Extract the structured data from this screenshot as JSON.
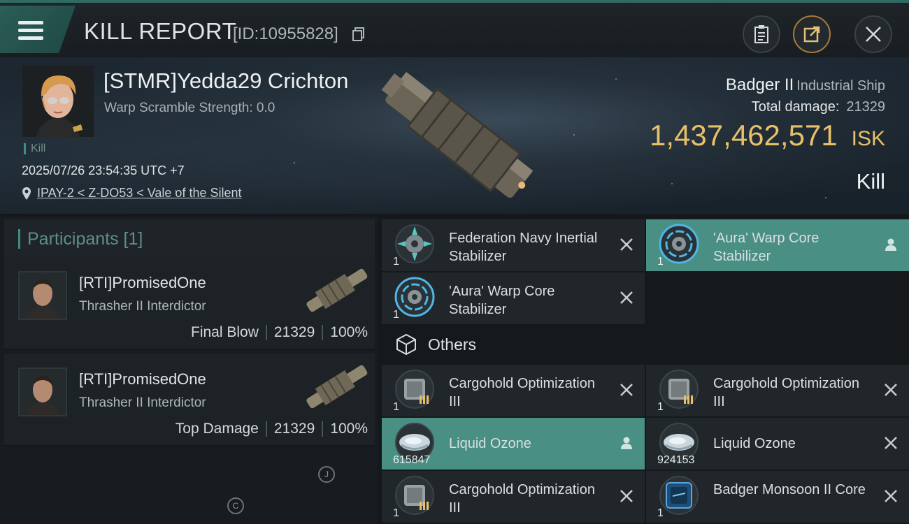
{
  "header": {
    "title": "KILL REPORT",
    "report_id": "[ID:10955828]",
    "menu_icon": "hamburger-icon",
    "actions": [
      {
        "name": "clipboard-icon"
      },
      {
        "name": "share-icon"
      },
      {
        "name": "close-icon"
      }
    ]
  },
  "victim": {
    "name": "[STMR]Yedda29 Crichton",
    "warp_scramble": "Warp Scramble Strength: 0.0",
    "tag": "Kill",
    "datetime": "2025/07/26 23:54:35 UTC +7",
    "location": "IPAY-2 < Z-DO53 < Vale of the Silent",
    "ship_name": "Badger II",
    "ship_class": "Industrial Ship",
    "total_damage_label": "Total damage:",
    "total_damage": "21329",
    "isk_value": "1,437,462,571",
    "isk_unit": "ISK",
    "result": "Kill"
  },
  "participants": {
    "title": "Participants [1]",
    "list": [
      {
        "name": "[RTI]PromisedOne",
        "ship": "Thrasher II Interdictor",
        "role": "Final Blow",
        "damage": "21329",
        "percent": "100%"
      },
      {
        "name": "[RTI]PromisedOne",
        "ship": "Thrasher II Interdictor",
        "role": "Top Damage",
        "damage": "21329",
        "percent": "100%"
      }
    ],
    "markers": [
      "J",
      "C"
    ]
  },
  "items": {
    "fitted": [
      {
        "name": "Federation Navy Inertial Stabilizer",
        "qty": "1",
        "status": "destroyed"
      },
      {
        "name": "'Aura' Warp Core Stabilizer",
        "qty": "1",
        "status": "dropped"
      },
      {
        "name": "'Aura' Warp Core Stabilizer",
        "qty": "1",
        "status": "destroyed"
      }
    ],
    "others_label": "Others",
    "others": [
      {
        "name": "Cargohold Optimization III",
        "qty": "1",
        "status": "destroyed"
      },
      {
        "name": "Cargohold Optimization III",
        "qty": "1",
        "status": "destroyed"
      },
      {
        "name": "Liquid Ozone",
        "qty": "615847",
        "status": "dropped"
      },
      {
        "name": "Liquid Ozone",
        "qty": "924153",
        "status": "destroyed"
      },
      {
        "name": "Cargohold Optimization III",
        "qty": "1",
        "status": "destroyed"
      },
      {
        "name": "Badger Monsoon II Core",
        "qty": "1",
        "status": "destroyed"
      }
    ]
  },
  "colors": {
    "accent": "#4a8f84",
    "isk": "#e8c06a",
    "background": "#14181c"
  }
}
